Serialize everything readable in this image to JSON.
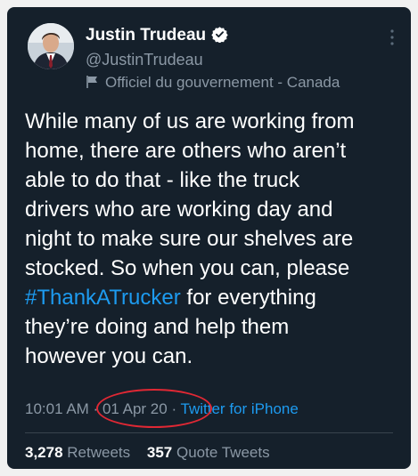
{
  "author": {
    "name": "Justin Trudeau",
    "handle": "@JustinTrudeau",
    "label": "Officiel du gouvernement - Canada"
  },
  "tweet": {
    "text_before": "While many of us are working from\nhome, there are others who aren’t\nable to do that - like the truck\ndrivers who are working day and\nnight to make sure our shelves are\nstocked. So when you can, please\n",
    "hashtag": "#ThankATrucker",
    "text_after": " for everything\nthey’re doing and help them\nhowever you can."
  },
  "meta": {
    "time": "10:01 AM",
    "separator": " · ",
    "date": "01 Apr 20",
    "source": "Twitter for iPhone"
  },
  "stats": {
    "retweets_count": "3,278",
    "retweets_label": "Retweets",
    "quotes_count": "357",
    "quotes_label": "Quote Tweets"
  },
  "colors": {
    "background": "#15202b",
    "accent": "#1d9bf0",
    "secondary_text": "#8b98a5",
    "annotation": "#e02834"
  }
}
